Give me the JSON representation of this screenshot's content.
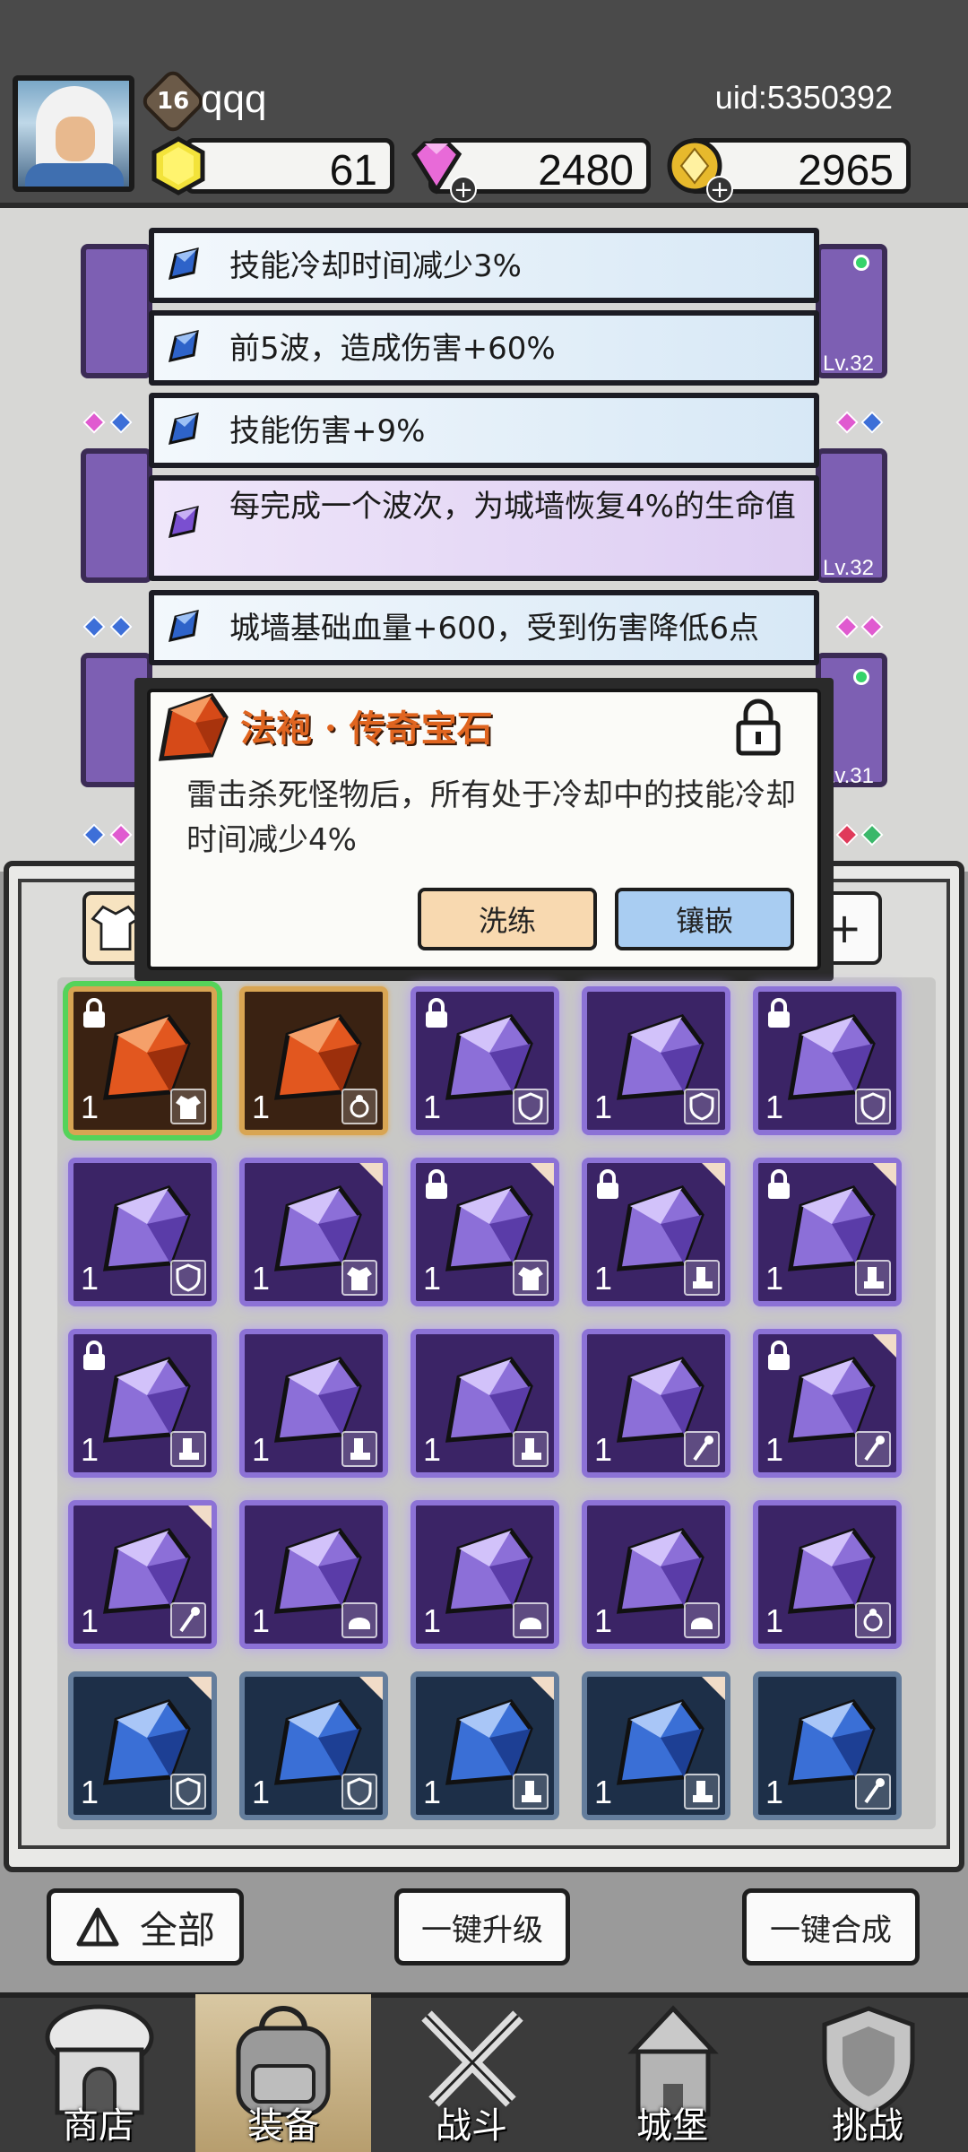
{
  "player": {
    "level": "16",
    "name": "qqq",
    "uid": "uid:5350392"
  },
  "currencies": [
    {
      "name": "gold-crystal",
      "value": "61"
    },
    {
      "name": "pink-diamond",
      "value": "2480"
    },
    {
      "name": "gold-coin",
      "value": "2965"
    }
  ],
  "equip_levels": [
    "Lv.32",
    "Lv.32",
    "Lv.31"
  ],
  "skills": [
    {
      "text": "技能冷却时间减少3%",
      "rarity": "blue"
    },
    {
      "text": "前5波，造成伤害+60%",
      "rarity": "blue"
    },
    {
      "text": "技能伤害+9%",
      "rarity": "blue"
    },
    {
      "text": "每完成一个波次，为城墙恢复4%的生命值",
      "rarity": "purple"
    },
    {
      "text": "城墙基础血量+600，受到伤害降低6点",
      "rarity": "blue"
    }
  ],
  "popup": {
    "title": "法袍 · 传奇宝石",
    "description": "雷击杀死怪物后，所有处于冷却中的技能冷却时间减少4%",
    "refine_label": "洗练",
    "inlay_label": "镶嵌",
    "lock_icon": "padlock-icon"
  },
  "inventory": {
    "plus_label": "+",
    "items": [
      {
        "color": "orange",
        "count": "1",
        "type": "robe",
        "locked": true,
        "selected": true,
        "new": false
      },
      {
        "color": "orange",
        "count": "1",
        "type": "ring",
        "locked": false,
        "selected": false,
        "new": false
      },
      {
        "color": "purple",
        "count": "1",
        "type": "shield",
        "locked": true,
        "new": false
      },
      {
        "color": "purple",
        "count": "1",
        "type": "shield",
        "locked": false,
        "new": false
      },
      {
        "color": "purple",
        "count": "1",
        "type": "shield",
        "locked": true,
        "new": false
      },
      {
        "color": "purple",
        "count": "1",
        "type": "shield",
        "locked": false,
        "new": false
      },
      {
        "color": "purple",
        "count": "1",
        "type": "robe",
        "locked": false,
        "new": true
      },
      {
        "color": "purple",
        "count": "1",
        "type": "robe",
        "locked": true,
        "new": true
      },
      {
        "color": "purple",
        "count": "1",
        "type": "boot",
        "locked": true,
        "new": true
      },
      {
        "color": "purple",
        "count": "1",
        "type": "boot",
        "locked": true,
        "new": true
      },
      {
        "color": "purple",
        "count": "1",
        "type": "boot",
        "locked": true,
        "new": false
      },
      {
        "color": "purple",
        "count": "1",
        "type": "boot",
        "locked": false,
        "new": false
      },
      {
        "color": "purple",
        "count": "1",
        "type": "boot",
        "locked": false,
        "new": false
      },
      {
        "color": "purple",
        "count": "1",
        "type": "staff",
        "locked": false,
        "new": false
      },
      {
        "color": "purple",
        "count": "1",
        "type": "staff",
        "locked": true,
        "new": true
      },
      {
        "color": "purple",
        "count": "1",
        "type": "staff",
        "locked": false,
        "new": true
      },
      {
        "color": "purple",
        "count": "1",
        "type": "helmet",
        "locked": false,
        "new": false
      },
      {
        "color": "purple",
        "count": "1",
        "type": "helmet",
        "locked": false,
        "new": false
      },
      {
        "color": "purple",
        "count": "1",
        "type": "helmet",
        "locked": false,
        "new": false
      },
      {
        "color": "purple",
        "count": "1",
        "type": "ring",
        "locked": false,
        "new": false
      },
      {
        "color": "blue",
        "count": "1",
        "type": "shield",
        "locked": false,
        "new": true
      },
      {
        "color": "blue",
        "count": "1",
        "type": "shield",
        "locked": false,
        "new": true
      },
      {
        "color": "blue",
        "count": "1",
        "type": "boot",
        "locked": false,
        "new": true
      },
      {
        "color": "blue",
        "count": "1",
        "type": "boot",
        "locked": false,
        "new": true
      },
      {
        "color": "blue",
        "count": "1",
        "type": "staff",
        "locked": false,
        "new": false
      }
    ]
  },
  "actions": {
    "all_label": "全部",
    "upgrade_label": "一键升级",
    "merge_label": "一键合成"
  },
  "nav": [
    {
      "label": "商店",
      "icon": "shop-icon",
      "active": false
    },
    {
      "label": "装备",
      "icon": "backpack-icon",
      "active": true
    },
    {
      "label": "战斗",
      "icon": "crossed-swords-icon",
      "active": false
    },
    {
      "label": "城堡",
      "icon": "castle-icon",
      "active": false
    },
    {
      "label": "挑战",
      "icon": "shield-challenge-icon",
      "active": false
    }
  ],
  "colors": {
    "purple_gem": "#8c6fd8",
    "orange_gem": "#e2571f",
    "blue_gem": "#3a6fd6",
    "popup_title": "#e06520"
  }
}
